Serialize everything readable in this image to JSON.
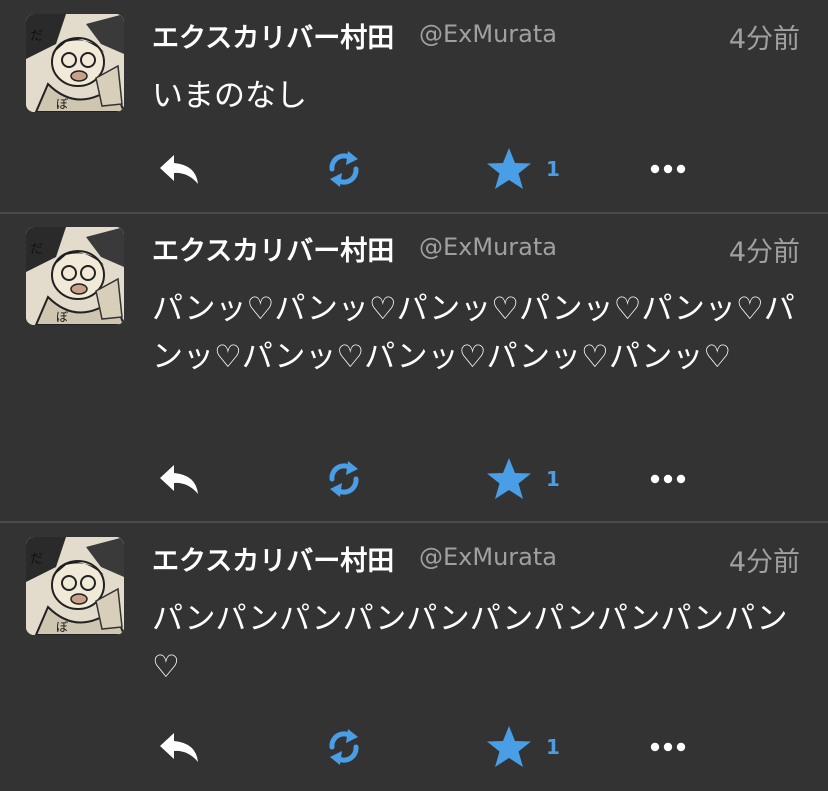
{
  "colors": {
    "background": "#333333",
    "divider": "#4a4a4a",
    "accent": "#4a9ee6",
    "muted": "#a0a0a0"
  },
  "tweets": [
    {
      "name": "エクスカリバー村田",
      "handle": "@ExMurata",
      "time": "4分前",
      "text": "いまのなし",
      "fav_count": "1"
    },
    {
      "name": "エクスカリバー村田",
      "handle": "@ExMurata",
      "time": "4分前",
      "text": "パンッ♡パンッ♡パンッ♡パンッ♡パンッ♡パンッ♡パンッ♡パンッ♡パンッ♡パンッ♡",
      "fav_count": "1"
    },
    {
      "name": "エクスカリバー村田",
      "handle": "@ExMurata",
      "time": "4分前",
      "text": "パンパンパンパンパンパンパンパンパンパン♡",
      "fav_count": "1"
    }
  ],
  "icons": {
    "reply": "reply-arrow-icon",
    "retweet": "retweet-icon",
    "favorite": "star-icon",
    "more": "more-dots-icon"
  }
}
